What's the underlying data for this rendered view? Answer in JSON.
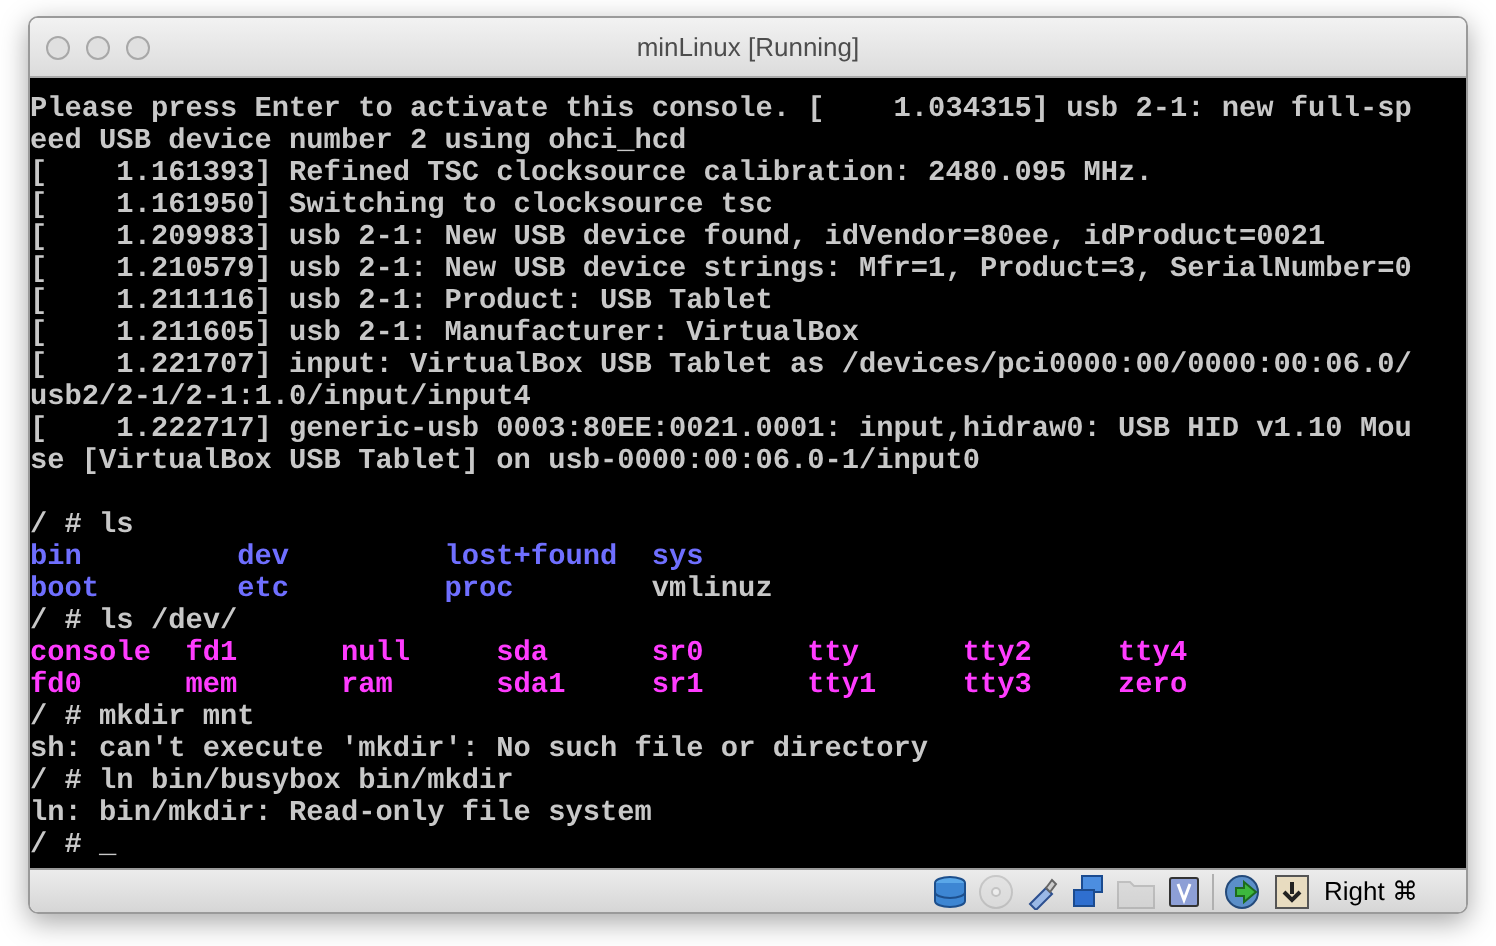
{
  "window": {
    "title": "minLinux [Running]"
  },
  "console": [
    {
      "kind": "text",
      "text": "Please press Enter to activate this console. [    1.034315] usb 2-1: new full-sp"
    },
    {
      "kind": "text",
      "text": "eed USB device number 2 using ohci_hcd"
    },
    {
      "kind": "text",
      "text": "[    1.161393] Refined TSC clocksource calibration: 2480.095 MHz."
    },
    {
      "kind": "text",
      "text": "[    1.161950] Switching to clocksource tsc"
    },
    {
      "kind": "text",
      "text": "[    1.209983] usb 2-1: New USB device found, idVendor=80ee, idProduct=0021"
    },
    {
      "kind": "text",
      "text": "[    1.210579] usb 2-1: New USB device strings: Mfr=1, Product=3, SerialNumber=0"
    },
    {
      "kind": "text",
      "text": "[    1.211116] usb 2-1: Product: USB Tablet"
    },
    {
      "kind": "text",
      "text": "[    1.211605] usb 2-1: Manufacturer: VirtualBox"
    },
    {
      "kind": "text",
      "text": "[    1.221707] input: VirtualBox USB Tablet as /devices/pci0000:00/0000:00:06.0/"
    },
    {
      "kind": "text",
      "text": "usb2/2-1/2-1:1.0/input/input4"
    },
    {
      "kind": "text",
      "text": "[    1.222717] generic-usb 0003:80EE:0021.0001: input,hidraw0: USB HID v1.10 Mou"
    },
    {
      "kind": "text",
      "text": "se [VirtualBox USB Tablet] on usb-0000:00:06.0-1/input0"
    },
    {
      "kind": "blank"
    },
    {
      "kind": "text",
      "text": "/ # ls"
    },
    {
      "kind": "listing",
      "rows": [
        [
          {
            "name": "bin",
            "color": "#6f6fff"
          },
          {
            "name": "dev",
            "color": "#6f6fff"
          },
          {
            "name": "lost+found",
            "color": "#6f6fff"
          },
          {
            "name": "sys",
            "color": "#6f6fff"
          }
        ],
        [
          {
            "name": "boot",
            "color": "#6f6fff"
          },
          {
            "name": "etc",
            "color": "#6f6fff"
          },
          {
            "name": "proc",
            "color": "#6f6fff"
          },
          {
            "name": "vmlinuz",
            "color": "#c8c8c8"
          }
        ]
      ]
    },
    {
      "kind": "text",
      "text": "/ # ls /dev/"
    },
    {
      "kind": "listing",
      "rows": [
        [
          {
            "name": "console",
            "color": "#ff3cff"
          },
          {
            "name": "fd1",
            "color": "#ff3cff"
          },
          {
            "name": "null",
            "color": "#ff3cff"
          },
          {
            "name": "sda",
            "color": "#ff3cff"
          },
          {
            "name": "sr0",
            "color": "#ff3cff"
          },
          {
            "name": "tty",
            "color": "#ff3cff"
          },
          {
            "name": "tty2",
            "color": "#ff3cff"
          },
          {
            "name": "tty4",
            "color": "#ff3cff"
          }
        ],
        [
          {
            "name": "fd0",
            "color": "#ff3cff"
          },
          {
            "name": "mem",
            "color": "#ff3cff"
          },
          {
            "name": "ram",
            "color": "#ff3cff"
          },
          {
            "name": "sda1",
            "color": "#ff3cff"
          },
          {
            "name": "sr1",
            "color": "#ff3cff"
          },
          {
            "name": "tty1",
            "color": "#ff3cff"
          },
          {
            "name": "tty3",
            "color": "#ff3cff"
          },
          {
            "name": "zero",
            "color": "#ff3cff"
          }
        ]
      ]
    },
    {
      "kind": "text",
      "text": "/ # mkdir mnt"
    },
    {
      "kind": "text",
      "text": "sh: can't execute 'mkdir': No such file or directory"
    },
    {
      "kind": "text",
      "text": "/ # ln bin/busybox bin/mkdir"
    },
    {
      "kind": "text",
      "text": "ln: bin/mkdir: Read-only file system"
    },
    {
      "kind": "text",
      "text": "/ # _"
    }
  ],
  "status_bar": {
    "icons": [
      {
        "kind": "disk",
        "active": true
      },
      {
        "kind": "optical",
        "active": false
      },
      {
        "kind": "usb",
        "active": true
      },
      {
        "kind": "network",
        "active": true
      },
      {
        "kind": "shared-folder",
        "active": false
      },
      {
        "kind": "remote-display",
        "active": true
      },
      {
        "kind": "separator"
      },
      {
        "kind": "mouse-integration",
        "active": true
      },
      {
        "kind": "keyboard-capture",
        "active": true
      }
    ],
    "host_key": "Right ⌘"
  }
}
